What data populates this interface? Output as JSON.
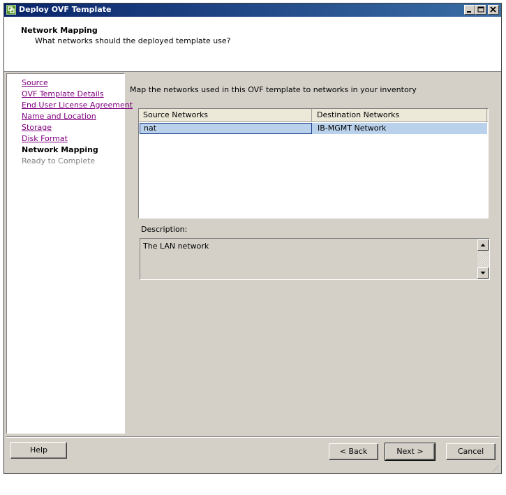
{
  "window": {
    "title": "Deploy OVF Template"
  },
  "header": {
    "title": "Network Mapping",
    "subtitle": "What networks should the deployed template use?"
  },
  "nav": {
    "items": [
      {
        "label": "Source",
        "state": "link"
      },
      {
        "label": "OVF Template Details",
        "state": "link"
      },
      {
        "label": "End User License Agreement",
        "state": "link"
      },
      {
        "label": "Name and Location",
        "state": "link"
      },
      {
        "label": "Storage",
        "state": "link"
      },
      {
        "label": "Disk Format",
        "state": "link"
      },
      {
        "label": "Network Mapping",
        "state": "current"
      },
      {
        "label": "Ready to Complete",
        "state": "future"
      }
    ]
  },
  "main": {
    "prompt": "Map the networks used in this OVF template to networks in your inventory",
    "table": {
      "columns": [
        "Source Networks",
        "Destination Networks"
      ],
      "rows": [
        {
          "source": "nat",
          "destination": "IB-MGMT Network"
        }
      ]
    },
    "description_label": "Description:",
    "description_text": "The LAN network"
  },
  "footer": {
    "help": "Help",
    "back": "< Back",
    "next": "Next >",
    "cancel": "Cancel"
  },
  "colors": {
    "titlebar_start": "#0a246a",
    "titlebar_end": "#3a6ea5",
    "selection": "#b9d1ea",
    "visited_link": "#800080",
    "chrome": "#d4d0c8"
  }
}
